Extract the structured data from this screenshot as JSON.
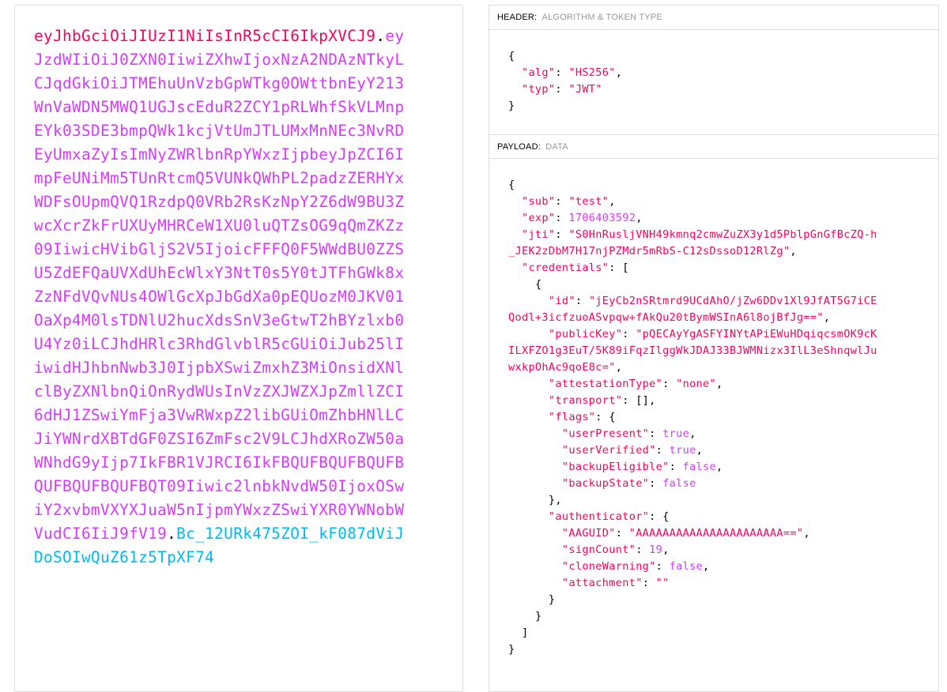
{
  "encoded": {
    "header_part": "eyJhbGciOiJIUzI1NiIsInR5cCI6IkpXVCJ9",
    "payload_part": "eyJzdWIiOiJ0ZXN0IiwiZXhwIjoxNzA2NDAzNTkyLCJqdGkiOiJTMEhuUnVzbGpWTkg0OWttbnEyY213WnVaWDN5MWQ1UGJscEduR2ZCY1pRLWhfSkVLMnpEYk03SDE3bmpQWk1kcjVtUmJTLUMxMnNEc3NvRDEyUmxaZyIsImNyZWRlbnRpYWxzIjpbeyJpZCI6ImpFeUNiMm5TUnRtcmQ5VUNkQWhPL2padzZERHYxWDFsOUpmQVQ1RzdpQ0VRb2RsKzNpY2Z6dW9BU3ZwcXcrZkFrUXUyMHRCeW1XU0luQTZsOG9qQmZKZz09IiwicHVibGljS2V5IjoicFFFQ0F5WWdBU0ZZSU5ZdEFQaUVXdUhEcWlxY3NtT0s5Y0tJTFhGWk8xZzNFdVQvNUs4OWlGcXpJbGdXa0pEQUozM0JKV01OaXp4M0lsTDNlU2hucXdsSnV3eGtwT2hBYzlxb0U4Yz0iLCJhdHRlc3RhdGlvblR5cGUiOiJub25lIiwidHJhbnNwb3J0IjpbXSwiZmxhZ3MiOnsidXNlclByZXNlbnQiOnRydWUsInVzZXJWZXJpZmllZCI6dHJ1ZSwiYmFja3VwRWxpZ2libGUiOmZhbHNlLCJiYWNrdXBTdGF0ZSI6ZmFsc2V9LCJhdXRoZW50aWNhdG9yIjp7IkFBR1VJRCI6IkFBQUFBQUFBQUFBQUFBQUFBQUFBQT09Iiwic2lnbkNvdW50IjoxOSwiY2xvbmVXYXJuaW5nIjpmYWxzZSwiYXR0YWNobWVudCI6IiJ9fV19",
    "signature_part": "Bc_12URk475ZOI_kF087dViJDoSOIwQuZ61z5TpXF74",
    "dot": "."
  },
  "header_section": {
    "title": "HEADER:",
    "subtitle": "ALGORITHM & TOKEN TYPE",
    "json_text": "{\n  \"alg\": \"HS256\",\n  \"typ\": \"JWT\"\n}"
  },
  "payload_section": {
    "title": "PAYLOAD:",
    "subtitle": "DATA",
    "json_text": "{\n  \"sub\": \"test\",\n  \"exp\": 1706403592,\n  \"jti\": \"S0HnRusljVNH49kmnq2cmwZuZX3y1d5PblpGnGfBcZQ-h_JEK2zDbM7H17njPZMdr5mRbS-C12sDssoD12RlZg\",\n  \"credentials\": [\n    {\n      \"id\": \"jEyCb2nSRtmrd9UCdAhO/jZw6DDv1Xl9JfAT5G7iCEQodl+3icfzuoASvpqw+fAkQu20tBymWSInA6l8ojBfJg==\",\n      \"publicKey\": \"pQECAyYgASFYINYtAPiEWuHDqiqcsmOK9cKILXFZO1g3EuT/5K89iFqzIlggWkJDAJ33BJWMNizx3IlL3eShnqwlJuwxkpOhAc9qoE8c=\",\n      \"attestationType\": \"none\",\n      \"transport\": [],\n      \"flags\": {\n        \"userPresent\": true,\n        \"userVerified\": true,\n        \"backupEligible\": false,\n        \"backupState\": false\n      },\n      \"authenticator\": {\n        \"AAGUID\": \"AAAAAAAAAAAAAAAAAAAAAA==\",\n        \"signCount\": 19,\n        \"cloneWarning\": false,\n        \"attachment\": \"\"\n      }\n    }\n  ]\n}"
  },
  "colors": {
    "header": "#fb015b",
    "payload": "#d63aff",
    "signature": "#00b9f1"
  }
}
